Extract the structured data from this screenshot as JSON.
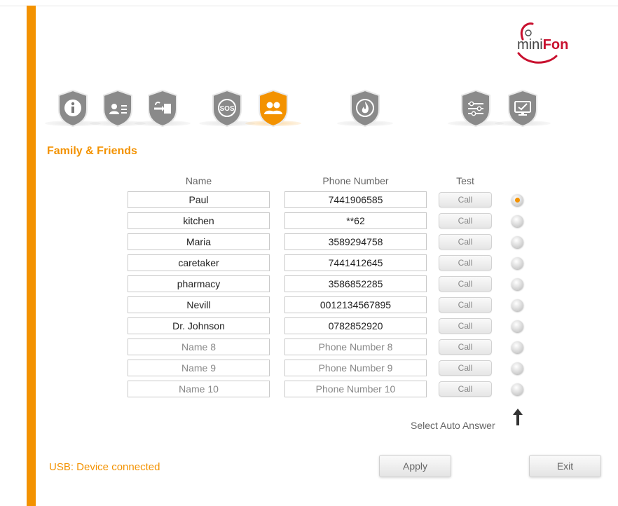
{
  "logo": {
    "mini": "mini",
    "fon": "Fon"
  },
  "nav": [
    {
      "icon": "info-icon",
      "symbol": "i",
      "active": false
    },
    {
      "icon": "contact-card-icon",
      "symbol": "card",
      "active": false
    },
    {
      "icon": "phone-transfer-icon",
      "symbol": "transfer",
      "active": false
    },
    {
      "icon": "sos-icon",
      "symbol": "SOS",
      "active": false
    },
    {
      "icon": "family-friends-icon",
      "symbol": "people",
      "active": true
    },
    {
      "icon": "fire-alarm-icon",
      "symbol": "flame",
      "active": false
    },
    {
      "icon": "settings-sliders-icon",
      "symbol": "sliders",
      "active": false
    },
    {
      "icon": "monitor-check-icon",
      "symbol": "monitor",
      "active": false
    }
  ],
  "section_title": "Family & Friends",
  "headers": {
    "name": "Name",
    "phone": "Phone Number",
    "test": "Test"
  },
  "contacts": [
    {
      "name": "Paul",
      "phone": "7441906585",
      "name_placeholder": "",
      "phone_placeholder": "",
      "selected": true
    },
    {
      "name": "kitchen",
      "phone": "**62",
      "name_placeholder": "",
      "phone_placeholder": "",
      "selected": false
    },
    {
      "name": "Maria",
      "phone": "3589294758",
      "name_placeholder": "",
      "phone_placeholder": "",
      "selected": false
    },
    {
      "name": "caretaker",
      "phone": "7441412645",
      "name_placeholder": "",
      "phone_placeholder": "",
      "selected": false
    },
    {
      "name": "pharmacy",
      "phone": "3586852285",
      "name_placeholder": "",
      "phone_placeholder": "",
      "selected": false
    },
    {
      "name": "Nevill",
      "phone": "0012134567895",
      "name_placeholder": "",
      "phone_placeholder": "",
      "selected": false
    },
    {
      "name": "Dr. Johnson",
      "phone": "0782852920",
      "name_placeholder": "",
      "phone_placeholder": "",
      "selected": false
    },
    {
      "name": "",
      "phone": "",
      "name_placeholder": "Name 8",
      "phone_placeholder": "Phone Number 8",
      "selected": false
    },
    {
      "name": "",
      "phone": "",
      "name_placeholder": "Name 9",
      "phone_placeholder": "Phone Number 9",
      "selected": false
    },
    {
      "name": "",
      "phone": "",
      "name_placeholder": "Name 10",
      "phone_placeholder": "Phone Number 10",
      "selected": false
    }
  ],
  "call_label": "Call",
  "auto_answer_label": "Select Auto Answer",
  "status_text": "USB: Device connected",
  "apply_label": "Apply",
  "exit_label": "Exit",
  "colors": {
    "accent": "#f39200",
    "logo_red": "#c8102e",
    "icon_gray": "#8a8a8a"
  }
}
